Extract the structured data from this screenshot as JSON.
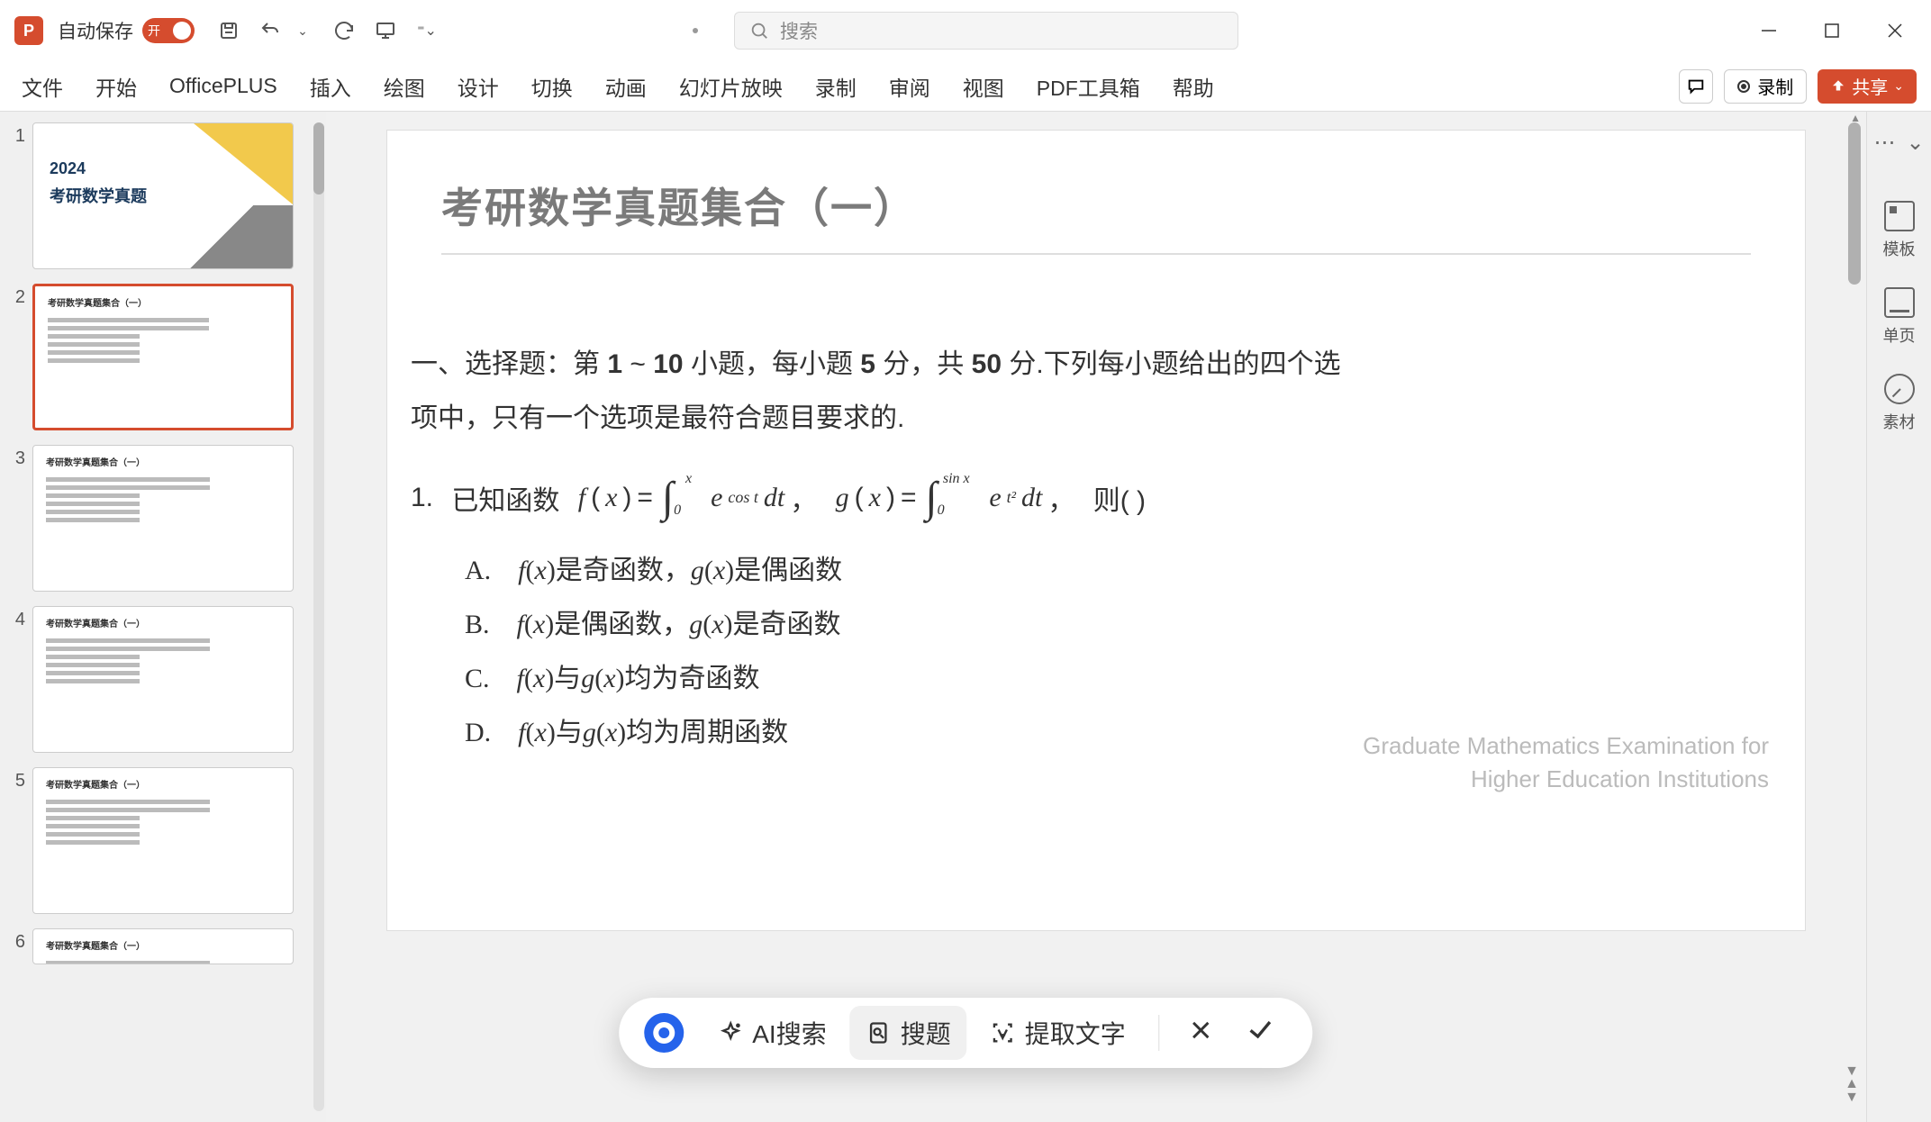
{
  "titlebar": {
    "app_letter": "P",
    "autosave_label": "自动保存",
    "autosave_state": "开",
    "search_placeholder": "搜索"
  },
  "ribbon": {
    "tabs": [
      "文件",
      "开始",
      "OfficePLUS",
      "插入",
      "绘图",
      "设计",
      "切换",
      "动画",
      "幻灯片放映",
      "录制",
      "审阅",
      "视图",
      "PDF工具箱",
      "帮助"
    ],
    "record_label": "录制",
    "share_label": "共享"
  },
  "thumbnails": {
    "year": "2024",
    "title": "考研数学真题",
    "content_title": "考研数学真题集合（一）",
    "numbers": [
      "1",
      "2",
      "3",
      "4",
      "5",
      "6"
    ]
  },
  "slide": {
    "title": "考研数学真题集合（一）",
    "section_header": "一、选择题：第 1 ~ 10 小题，每小题 5 分，共 50 分.下列每小题给出的四个选项中，只有一个选项是最符合题目要求的.",
    "question_num": "1.",
    "question_prefix": "已知函数",
    "f_label": "f",
    "g_label": "g",
    "var_x": "x",
    "eq": " = ",
    "upper_x": "x",
    "lower_0": "0",
    "e": "e",
    "cost": "cos t",
    "dt": "dt",
    "comma": "，",
    "upper_sinx": "sin x",
    "t2": "t²",
    "then": "则(        )",
    "options": {
      "a": "A.　f(x)是奇函数，g(x)是偶函数",
      "b": "B.　f(x)是偶函数，g(x)是奇函数",
      "c": "C.　f(x)与g(x)均为奇函数",
      "d": "D.　f(x)与g(x)均为周期函数"
    },
    "footer1": "Graduate Mathematics Examination for",
    "footer2": "Higher Education Institutions"
  },
  "right_panel": {
    "template": "模板",
    "single": "单页",
    "asset": "素材"
  },
  "floating_toolbar": {
    "ai_search": "AI搜索",
    "search_q": "搜题",
    "extract": "提取文字"
  }
}
